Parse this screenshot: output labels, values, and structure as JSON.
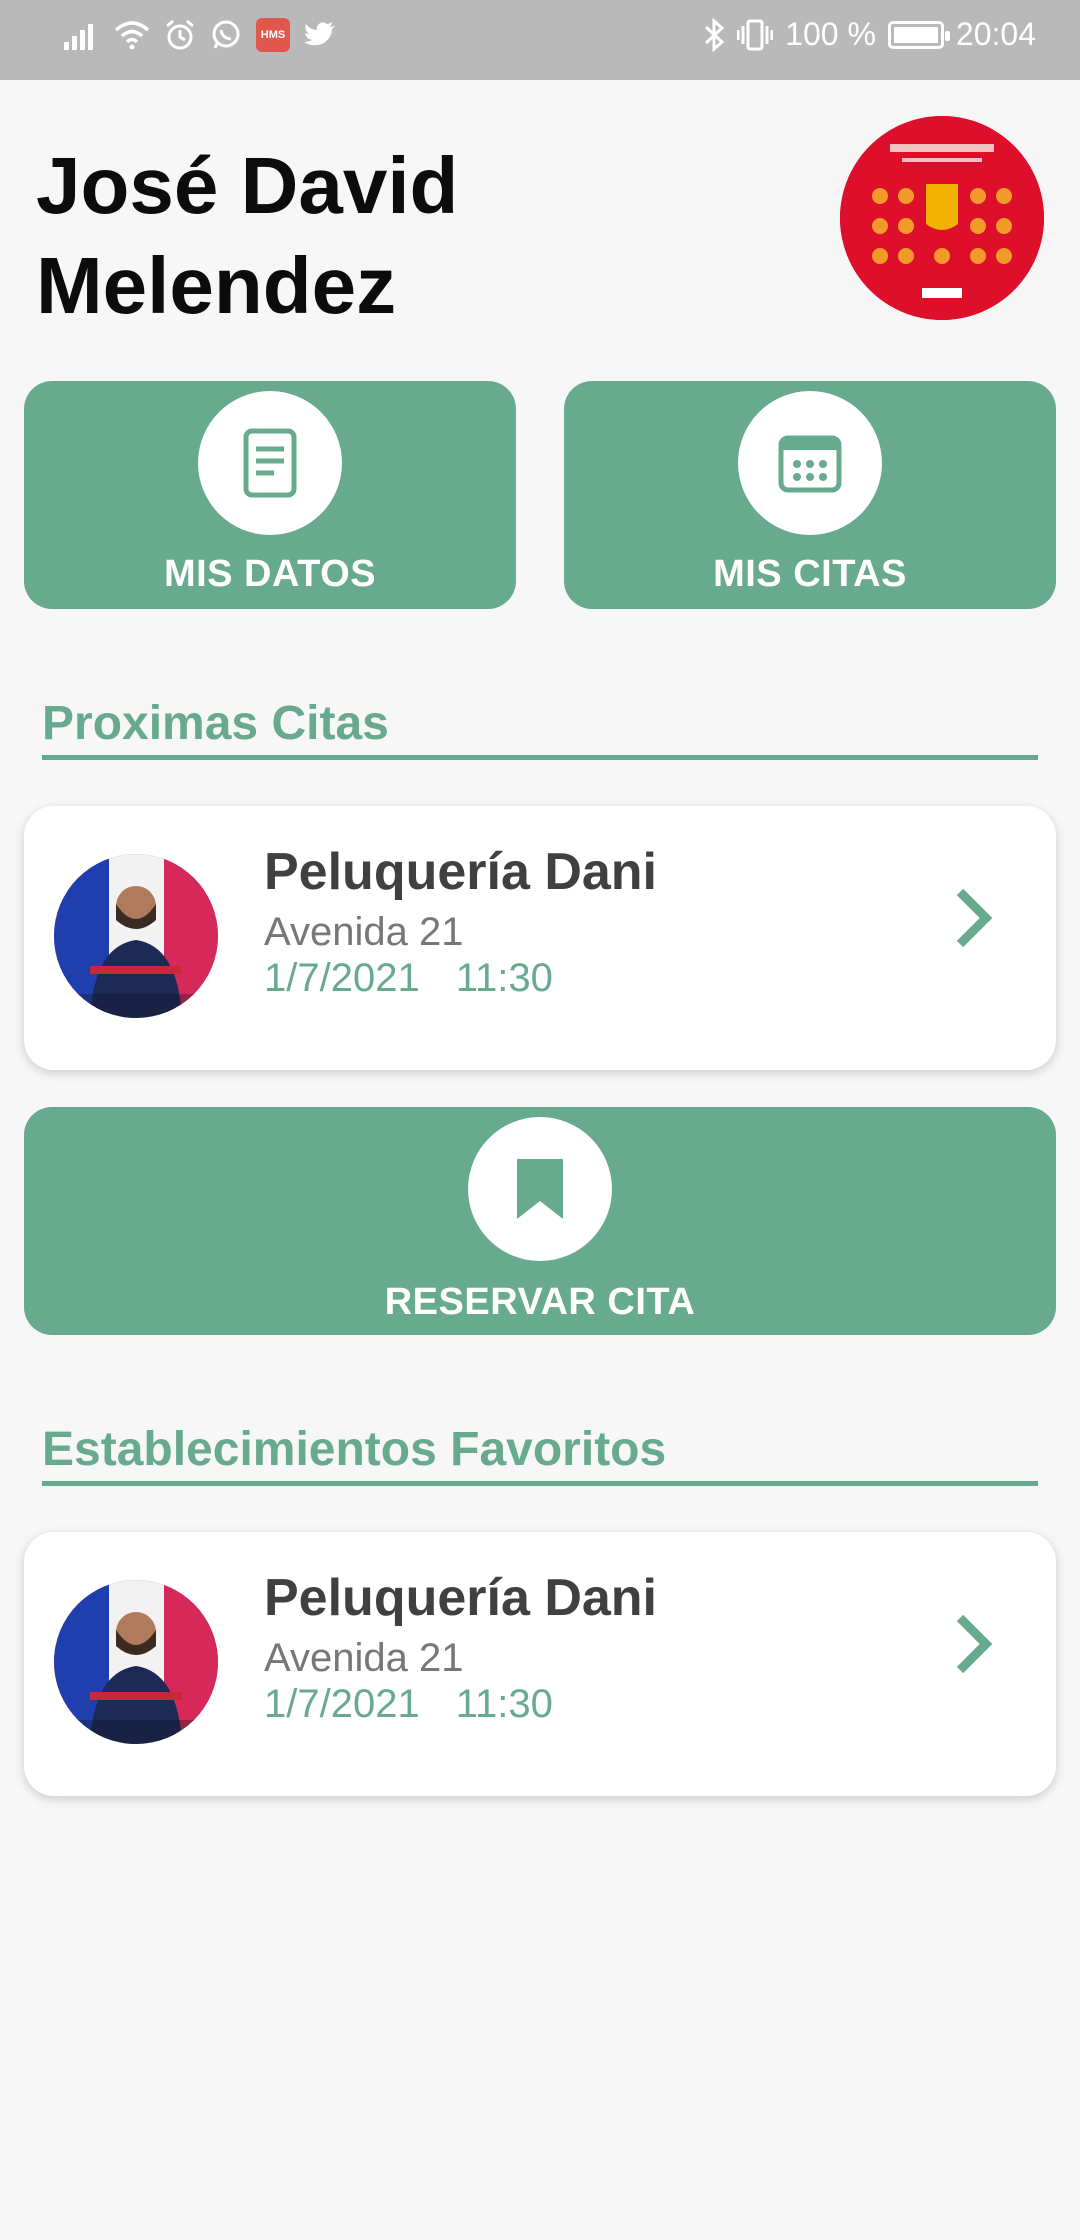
{
  "status_bar": {
    "battery_text": "100 %",
    "time": "20:04",
    "hms_badge": "HMS",
    "icons": [
      "signal-icon",
      "wifi-icon",
      "alarm-icon",
      "whatsapp-icon",
      "hms-icon",
      "twitter-icon",
      "bluetooth-icon",
      "vibrate-icon",
      "battery-icon"
    ]
  },
  "header": {
    "user_name": "José David Melendez"
  },
  "actions": {
    "mis_datos_label": "MIS DATOS",
    "mis_citas_label": "MIS CITAS",
    "reservar_cita_label": "RESERVAR CITA"
  },
  "proximas": {
    "title": "Proximas Citas",
    "card": {
      "name": "Peluquería Dani",
      "address": "Avenida 21",
      "date": "1/7/2021",
      "time": "11:30"
    }
  },
  "favoritos": {
    "title": "Establecimientos Favoritos",
    "card": {
      "name": "Peluquería Dani",
      "address": "Avenida 21",
      "date": "1/7/2021",
      "time": "11:30"
    }
  },
  "colors": {
    "accent": "#68aa8d",
    "status_bar": "#b9b9b9",
    "background": "#f7f7f7"
  }
}
